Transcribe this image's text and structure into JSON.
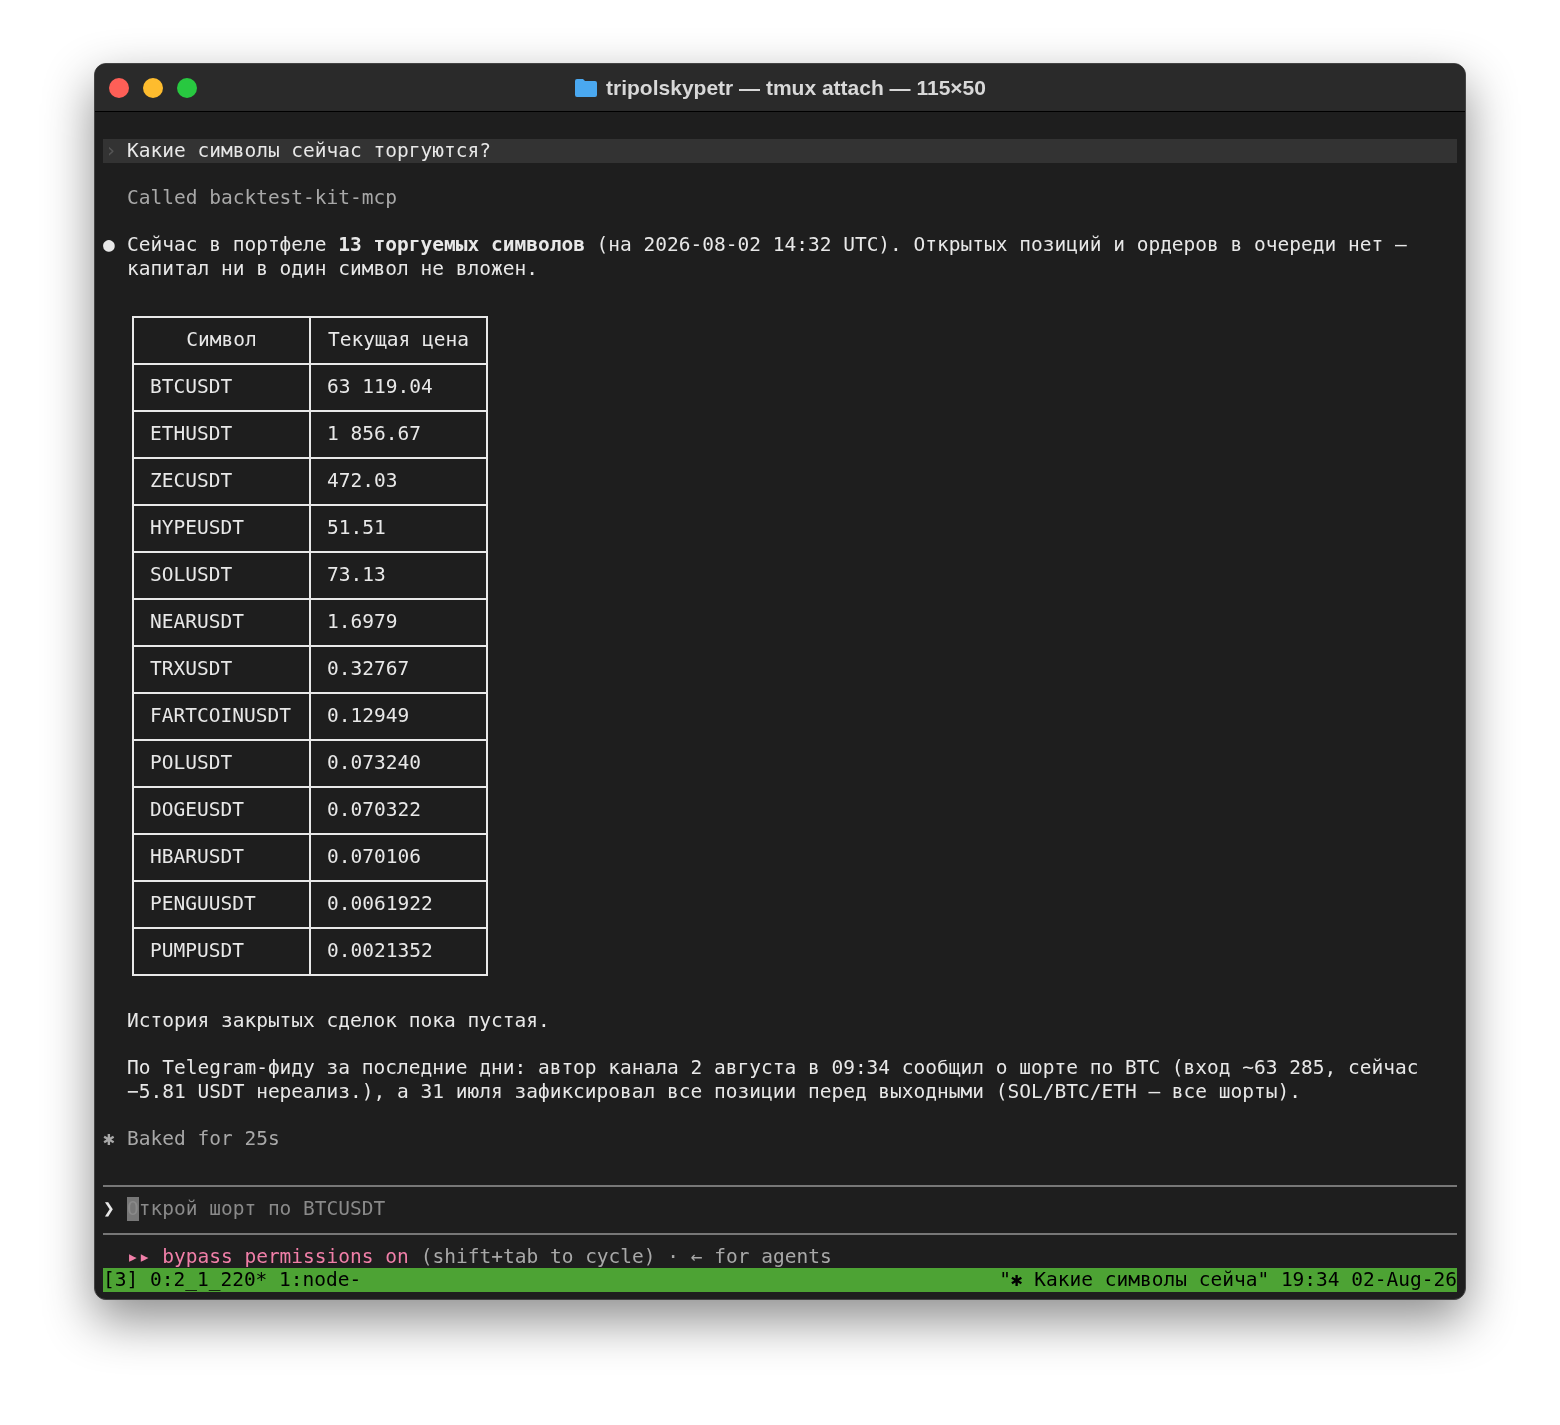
{
  "window": {
    "title": "tripolskypetr — tmux attach — 115×50"
  },
  "prompt": {
    "glyph": "›",
    "text": "Какие символы сейчас торгуются?"
  },
  "tool_call": "Called backtest-kit-mcp",
  "reply": {
    "bullet": "●",
    "text": "Сейчас в портфеле **13 торгуемых символов** (на 2026-08-02 14:32 UTC). Открытых позиций и ордеров в очереди нет — капитал ни в один символ не вложен."
  },
  "table": {
    "columns": [
      "Символ",
      "Текущая цена"
    ],
    "rows": [
      [
        "BTCUSDT",
        "63 119.04"
      ],
      [
        "ETHUSDT",
        "1 856.67"
      ],
      [
        "ZECUSDT",
        "472.03"
      ],
      [
        "HYPEUSDT",
        "51.51"
      ],
      [
        "SOLUSDT",
        "73.13"
      ],
      [
        "NEARUSDT",
        "1.6979"
      ],
      [
        "TRXUSDT",
        "0.32767"
      ],
      [
        "FARTCOINUSDT",
        "0.12949"
      ],
      [
        "POLUSDT",
        "0.073240"
      ],
      [
        "DOGEUSDT",
        "0.070322"
      ],
      [
        "HBARUSDT",
        "0.070106"
      ],
      [
        "PENGUUSDT",
        "0.0061922"
      ],
      [
        "PUMPUSDT",
        "0.0021352"
      ]
    ]
  },
  "paragraphs": [
    "История закрытых сделок пока пустая.",
    "По Telegram-фиду за последние дни: автор канала 2 августа в 09:34 сообщил о шорте по BTC (вход ~63 285, сейчас −5.81 USDT нереализ.), а 31 июля зафиксировал все позиции перед выходными (SOL/BTC/ETH — все шорты)."
  ],
  "status": {
    "glyph": "✱",
    "text": "Baked for 25s"
  },
  "input": {
    "glyph": "❯",
    "placeholder": "Открой шорт по BTCUSDT"
  },
  "mode_line": {
    "arrows": "▸▸",
    "label": "bypass permissions on",
    "hint": "(shift+tab to cycle) · ← for agents"
  },
  "tmux_status": {
    "left": "[3] 0:2_1_220* 1:node-",
    "right": "\"✱ Какие символы сейча\" 19:34 02-Aug-26"
  }
}
